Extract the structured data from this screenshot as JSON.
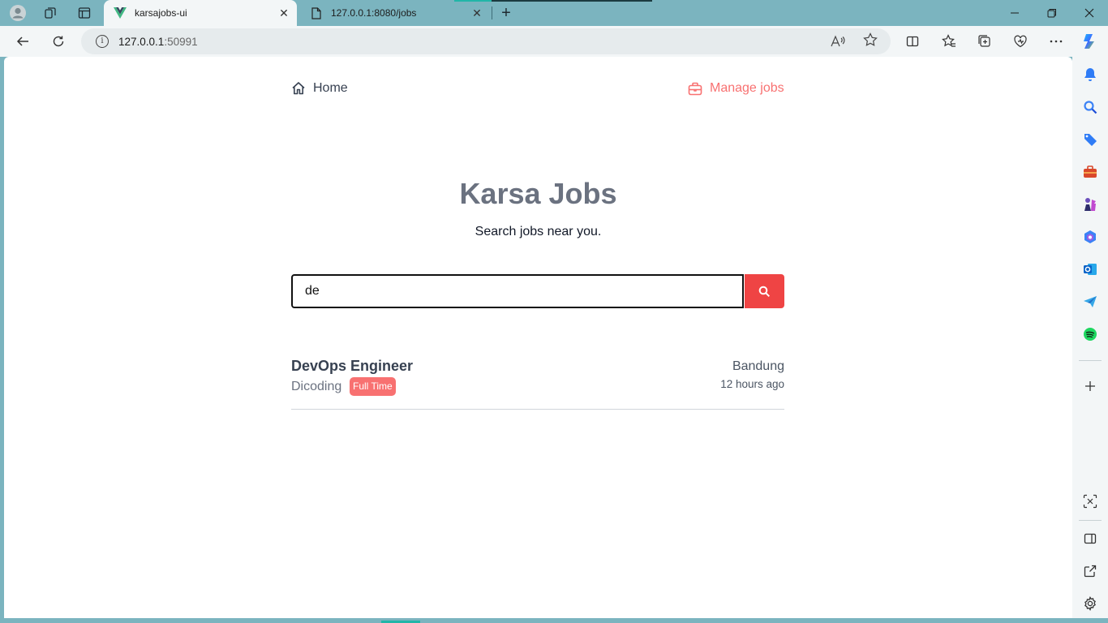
{
  "browser": {
    "tabs": [
      {
        "title": "karsajobs-ui",
        "favicon": "vue-logo-icon",
        "active": true
      },
      {
        "title": "127.0.0.1:8080/jobs",
        "favicon": "page-icon",
        "active": false
      }
    ],
    "address": {
      "host": "127.0.0.1",
      "port": ":50991"
    },
    "close_glyph": "✕",
    "new_tab_glyph": "+"
  },
  "nav": {
    "home_label": "Home",
    "manage_label": "Manage jobs"
  },
  "hero": {
    "title": "Karsa Jobs",
    "subtitle": "Search jobs near you."
  },
  "search": {
    "value": "de"
  },
  "jobs": [
    {
      "title": "DevOps Engineer",
      "company": "Dicoding",
      "type": "Full Time",
      "location": "Bandung",
      "posted": "12 hours ago"
    }
  ],
  "colors": {
    "accent": "#ef4444",
    "accent_light": "#f87171",
    "title_gray": "#6b7280",
    "browser_frame": "#7bb4bf"
  }
}
